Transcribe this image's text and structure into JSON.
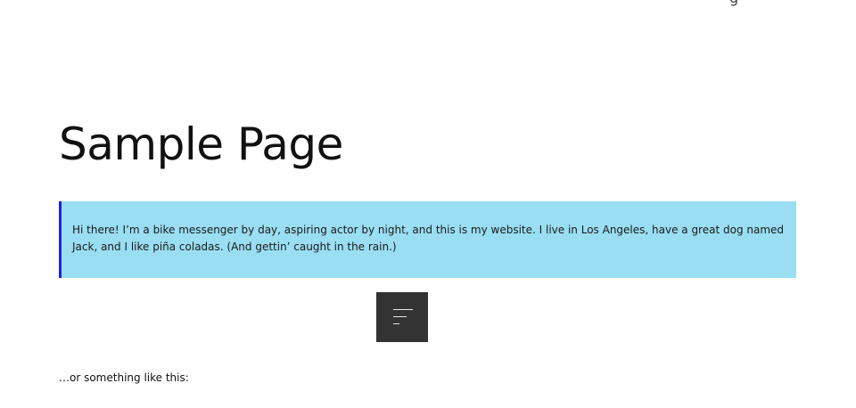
{
  "header": {
    "corner_glyph": "g"
  },
  "main": {
    "title": "Sample Page",
    "quote": "Hi there! I’m a bike messenger by day, aspiring actor by night, and this is my website. I live in Los Angeles, have a great dog named Jack, and I like piña coladas. (And gettin’ caught in the rain.)",
    "menu_toggle_icon": "menu-lines-icon",
    "after_text": "…or something like this:"
  },
  "colors": {
    "quote_background": "#9adef3",
    "quote_border": "#1f22e6",
    "toggle_background": "#333333"
  }
}
